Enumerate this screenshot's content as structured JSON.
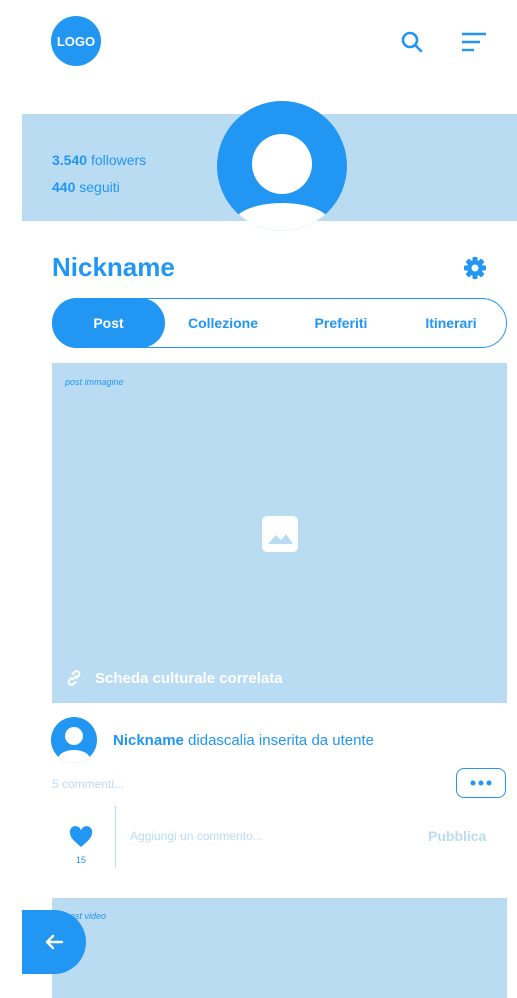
{
  "header": {
    "logo_text": "LOGO"
  },
  "profile": {
    "followers_count": "3.540",
    "followers_label": "followers",
    "following_count": "440",
    "following_label": "seguiti",
    "nickname": "Nickname"
  },
  "tabs": [
    {
      "label": "Post",
      "active": true
    },
    {
      "label": "Collezione",
      "active": false
    },
    {
      "label": "Preferiti",
      "active": false
    },
    {
      "label": "Itinerari",
      "active": false
    }
  ],
  "post": {
    "type_tag": "post immagine",
    "linked_card_label": "Scheda culturale correlata",
    "author": "Nickname",
    "caption": "didascalia inserita da utente",
    "comments_link": "5 commenti...",
    "like_count": "15",
    "comment_placeholder": "Aggiungi un commento...",
    "publish_label": "Pubblica"
  },
  "next_post": {
    "type_tag": "post video"
  },
  "colors": {
    "primary": "#2196f3",
    "light": "#badcf3",
    "white": "#ffffff"
  },
  "icons": [
    "search-icon",
    "menu-icon",
    "user-icon",
    "gear-icon",
    "image-placeholder-icon",
    "link-icon",
    "more-icon",
    "heart-icon",
    "arrow-left-icon"
  ]
}
